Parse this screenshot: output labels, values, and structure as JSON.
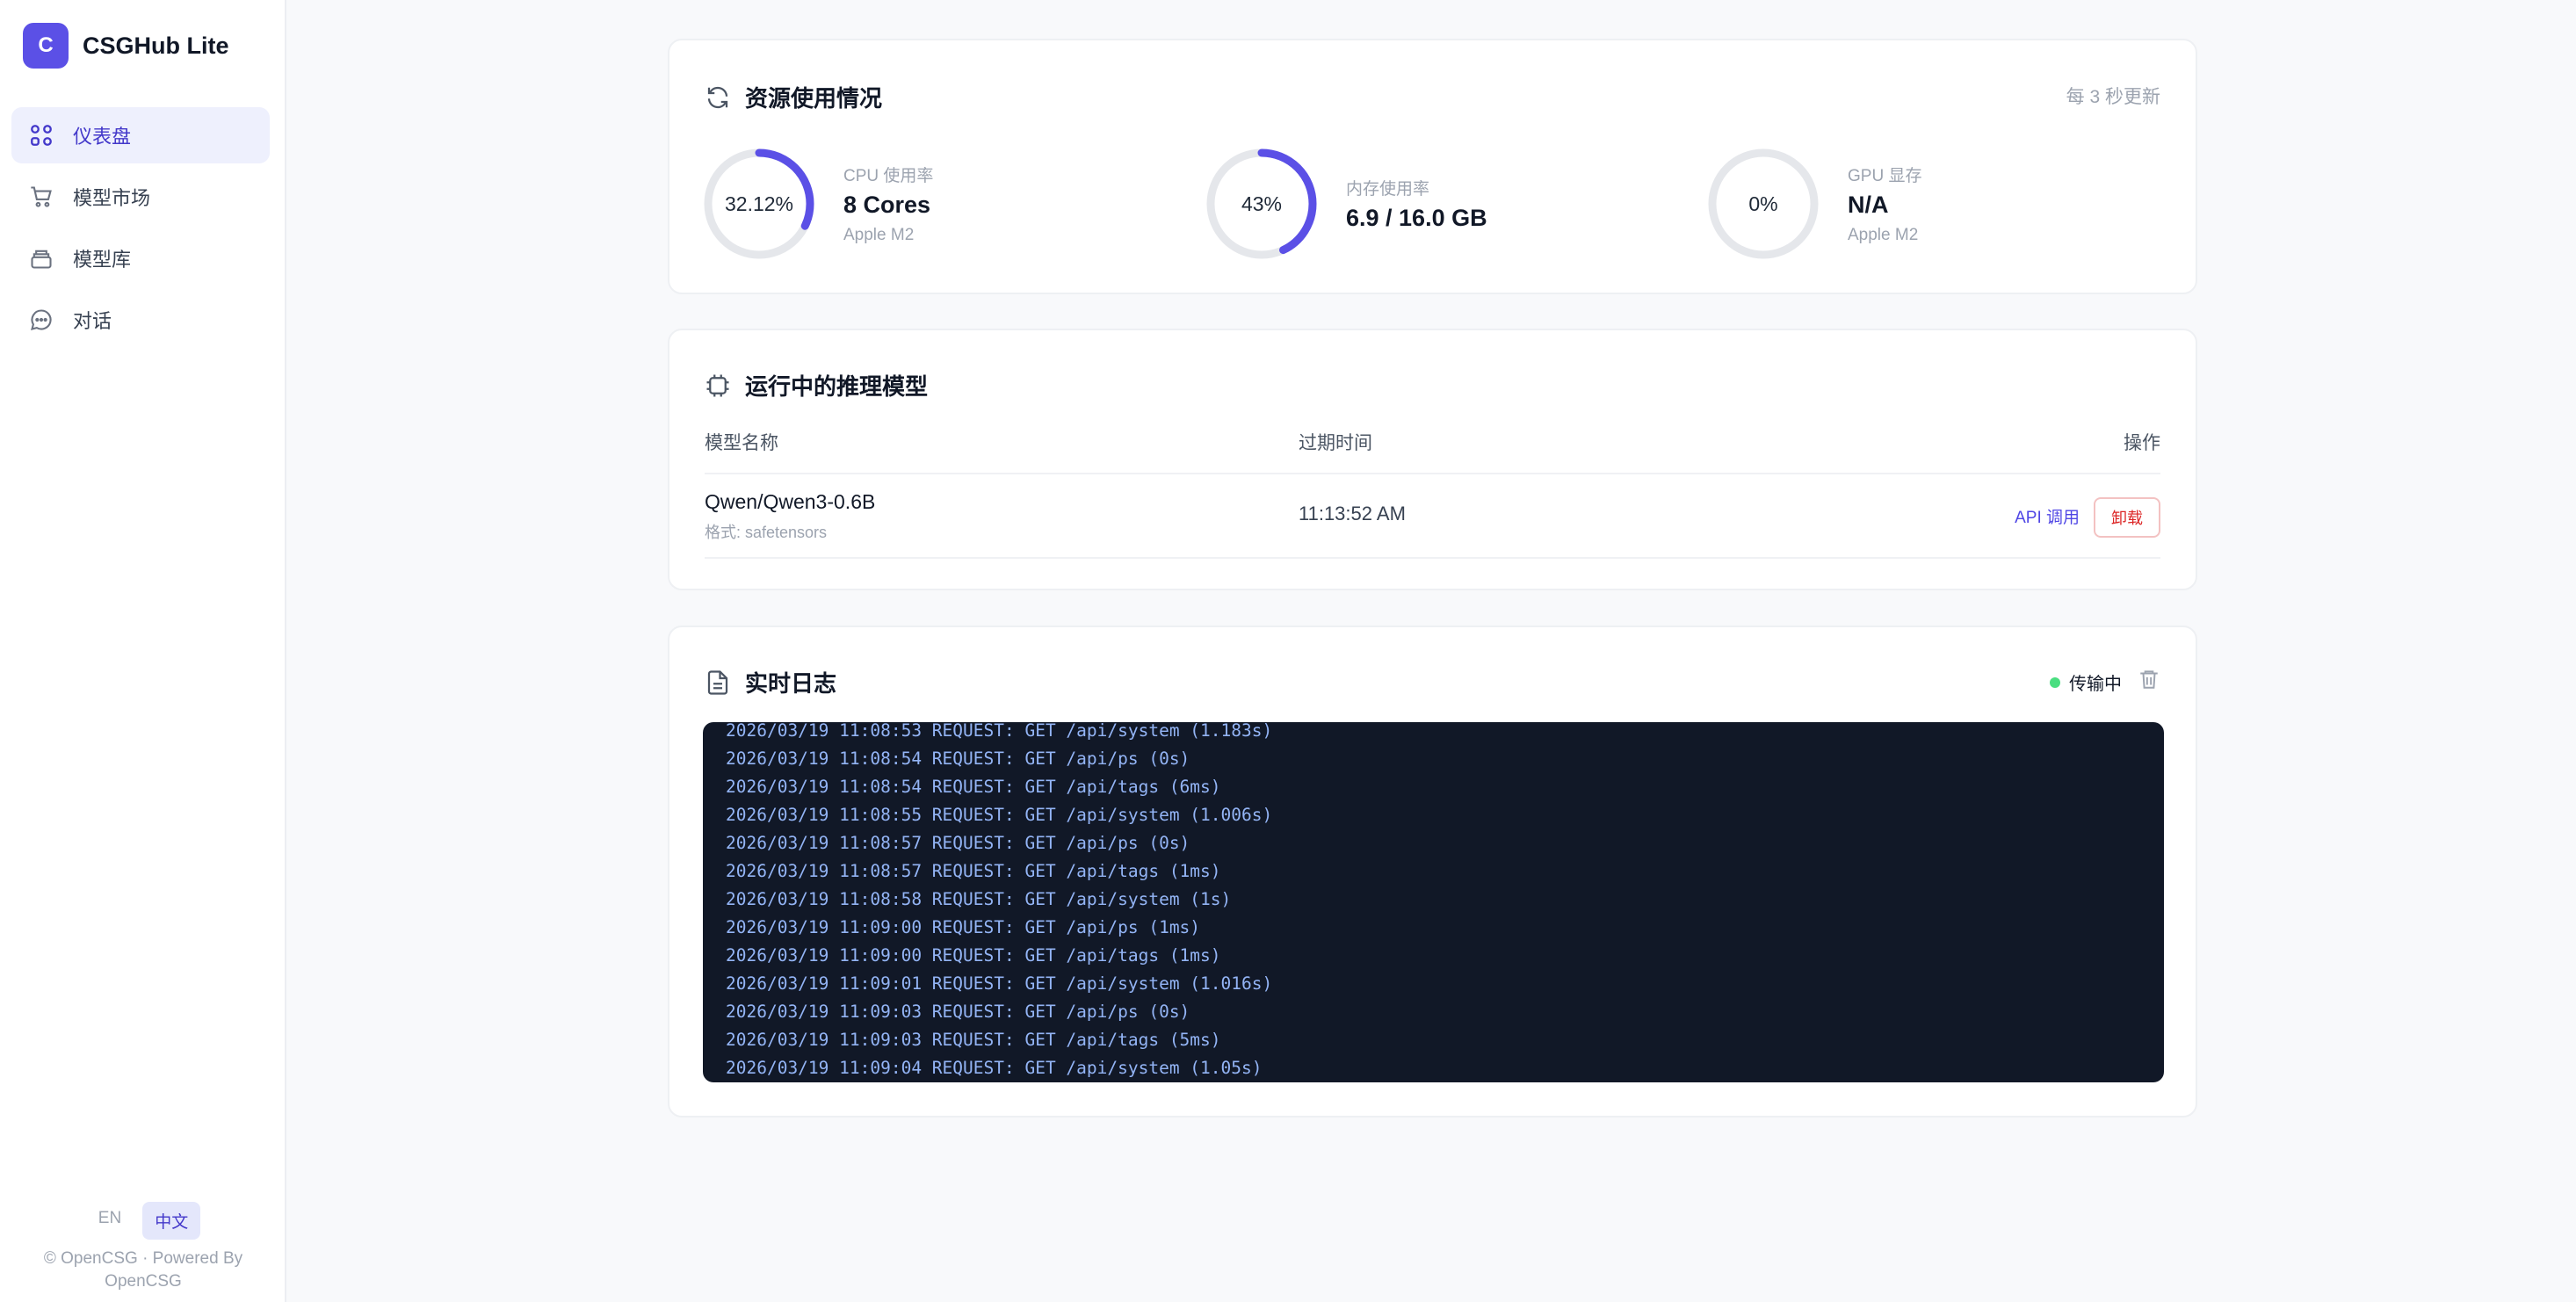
{
  "app": {
    "logo_letter": "C",
    "name": "CSGHub Lite"
  },
  "sidebar": {
    "items": [
      {
        "label": "仪表盘",
        "icon": "grid-icon",
        "active": true
      },
      {
        "label": "模型市场",
        "icon": "cart-icon",
        "active": false
      },
      {
        "label": "模型库",
        "icon": "layers-icon",
        "active": false
      },
      {
        "label": "对话",
        "icon": "chat-icon",
        "active": false
      }
    ],
    "lang": {
      "en": "EN",
      "zh": "中文",
      "active": "中文"
    },
    "footer": "© OpenCSG · Powered By OpenCSG"
  },
  "resources": {
    "title": "资源使用情况",
    "update_note": "每 3 秒更新",
    "cpu": {
      "percent_label": "32.12%",
      "fraction": 0.3212,
      "label": "CPU 使用率",
      "value": "8 Cores",
      "sub": "Apple M2"
    },
    "memory": {
      "percent_label": "43%",
      "fraction": 0.43,
      "label": "内存使用率",
      "value": "6.9 / 16.0 GB"
    },
    "gpu": {
      "percent_label": "0%",
      "fraction": 0,
      "label": "GPU 显存",
      "value": "N/A",
      "sub": "Apple M2"
    }
  },
  "models": {
    "title": "运行中的推理模型",
    "headers": {
      "name": "模型名称",
      "expire": "过期时间",
      "action": "操作"
    },
    "rows": [
      {
        "name": "Qwen/Qwen3-0.6B",
        "format": "格式: safetensors",
        "expire": "11:13:52 AM",
        "api": "API 调用",
        "unload": "卸载"
      }
    ]
  },
  "logs": {
    "title": "实时日志",
    "status": "传输中",
    "lines": [
      "2026/03/19 11:08:53 REQUEST: GET /api/system (1.183s)",
      "2026/03/19 11:08:54 REQUEST: GET /api/ps (0s)",
      "2026/03/19 11:08:54 REQUEST: GET /api/tags (6ms)",
      "2026/03/19 11:08:55 REQUEST: GET /api/system (1.006s)",
      "2026/03/19 11:08:57 REQUEST: GET /api/ps (0s)",
      "2026/03/19 11:08:57 REQUEST: GET /api/tags (1ms)",
      "2026/03/19 11:08:58 REQUEST: GET /api/system (1s)",
      "2026/03/19 11:09:00 REQUEST: GET /api/ps (1ms)",
      "2026/03/19 11:09:00 REQUEST: GET /api/tags (1ms)",
      "2026/03/19 11:09:01 REQUEST: GET /api/system (1.016s)",
      "2026/03/19 11:09:03 REQUEST: GET /api/ps (0s)",
      "2026/03/19 11:09:03 REQUEST: GET /api/tags (5ms)",
      "2026/03/19 11:09:04 REQUEST: GET /api/system (1.05s)"
    ]
  },
  "colors": {
    "accent": "#5b50e6",
    "ring_fill": "#5b50e6",
    "ring_track": "#e5e7eb",
    "console_bg": "#111827",
    "log_text": "#93b4f5",
    "status_dot": "#4ade80",
    "danger": "#dc2626"
  }
}
